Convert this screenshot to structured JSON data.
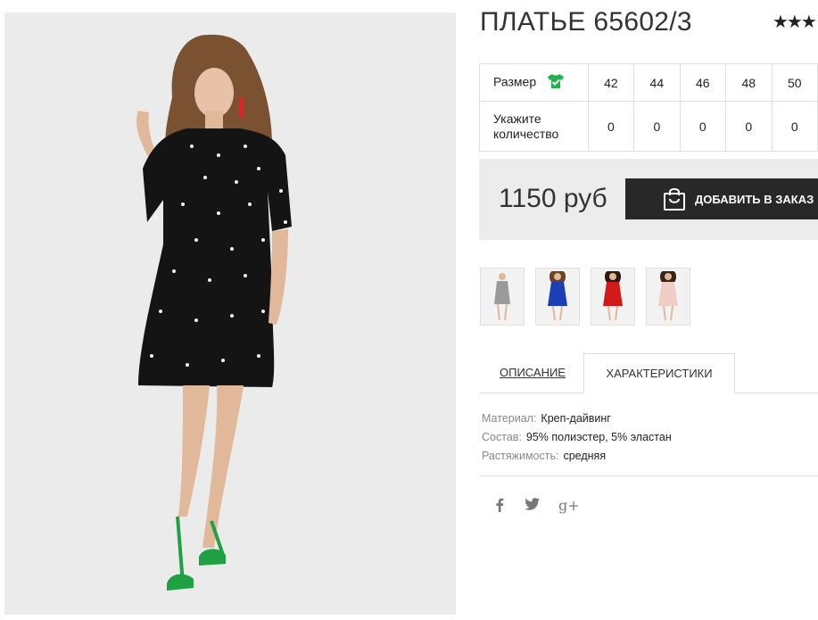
{
  "product": {
    "title": "ПЛАТЬЕ 65602/3",
    "rating_stars": "★★★"
  },
  "sizes": {
    "size_label": "Размер",
    "qty_label_line1": "Укажите",
    "qty_label_line2": "количество",
    "values": [
      "42",
      "44",
      "46",
      "48",
      "50"
    ],
    "quantities": [
      "0",
      "0",
      "0",
      "0",
      "0"
    ]
  },
  "purchase": {
    "price": "1150 руб",
    "add_button": "ДОБАВИТЬ В ЗАКАЗ"
  },
  "variants": [
    {
      "color": "#9a9a9a",
      "icon": "gray-dress-thumbnail"
    },
    {
      "color": "#1c3fb5",
      "icon": "blue-dress-thumbnail"
    },
    {
      "color": "#d31a1a",
      "icon": "red-dress-thumbnail"
    },
    {
      "color": "#f1cdc6",
      "icon": "pink-dress-thumbnail"
    }
  ],
  "tabs": {
    "description": "ОПИСАНИЕ",
    "characteristics": "ХАРАКТЕРИСТИКИ"
  },
  "specs": [
    {
      "key": "Материал:",
      "value": "Креп-дайвинг"
    },
    {
      "key": "Состав:",
      "value": "95% полиэстер, 5% эластан"
    },
    {
      "key": "Растяжимость:",
      "value": "средняя"
    }
  ],
  "social": {
    "facebook": "f",
    "twitter": "twitter-bird",
    "googleplus": "g+"
  },
  "colors": {
    "accent_green": "#22b14c",
    "button_dark": "#282828",
    "price_box": "#ececec"
  }
}
